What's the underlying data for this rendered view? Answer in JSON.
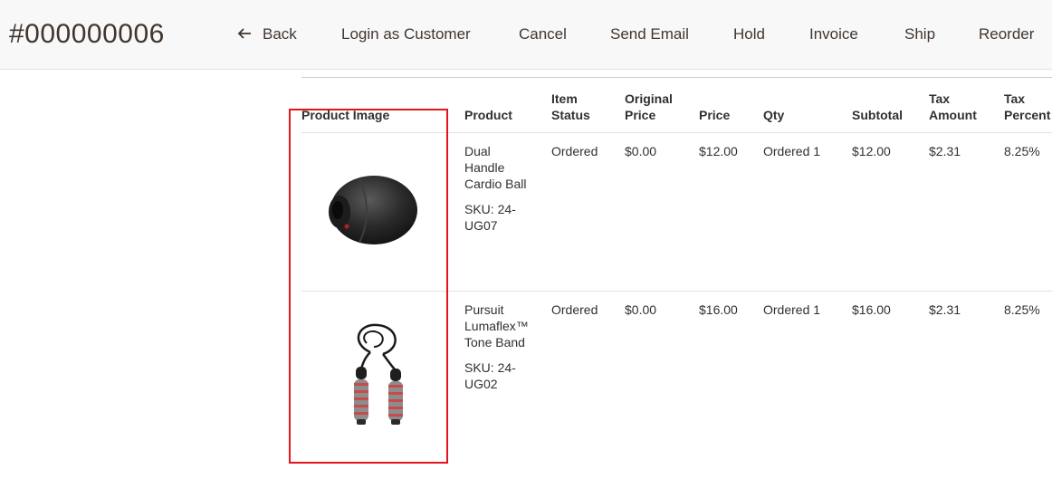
{
  "header": {
    "order_number": "#000000006",
    "actions": {
      "back": "Back",
      "login_as_customer": "Login as Customer",
      "cancel": "Cancel",
      "send_email": "Send Email",
      "hold": "Hold",
      "invoice": "Invoice",
      "ship": "Ship",
      "reorder": "Reorder"
    }
  },
  "items_table": {
    "columns": {
      "product_image": "Product Image",
      "product": "Product",
      "item_status": "Item Status",
      "original_price": "Original Price",
      "price": "Price",
      "qty": "Qty",
      "subtotal": "Subtotal",
      "tax_amount": "Tax Amount",
      "tax_percent": "Tax Percent"
    },
    "rows": [
      {
        "image_icon": "cardio-ball-image",
        "product_name": "Dual Handle Cardio Ball",
        "sku": "SKU: 24-UG07",
        "item_status": "Ordered",
        "original_price": "$0.00",
        "price": "$12.00",
        "qty": "Ordered 1",
        "subtotal": "$12.00",
        "tax_amount": "$2.31",
        "tax_percent": "8.25%"
      },
      {
        "image_icon": "tone-band-image",
        "product_name": "Pursuit Lumaflex™ Tone Band",
        "sku": "SKU: 24-UG02",
        "item_status": "Ordered",
        "original_price": "$0.00",
        "price": "$16.00",
        "qty": "Ordered 1",
        "subtotal": "$16.00",
        "tax_amount": "$2.31",
        "tax_percent": "8.25%"
      }
    ]
  },
  "colors": {
    "highlight": "#e3151a",
    "header_bg": "#f8f8f8",
    "text": "#303030"
  }
}
